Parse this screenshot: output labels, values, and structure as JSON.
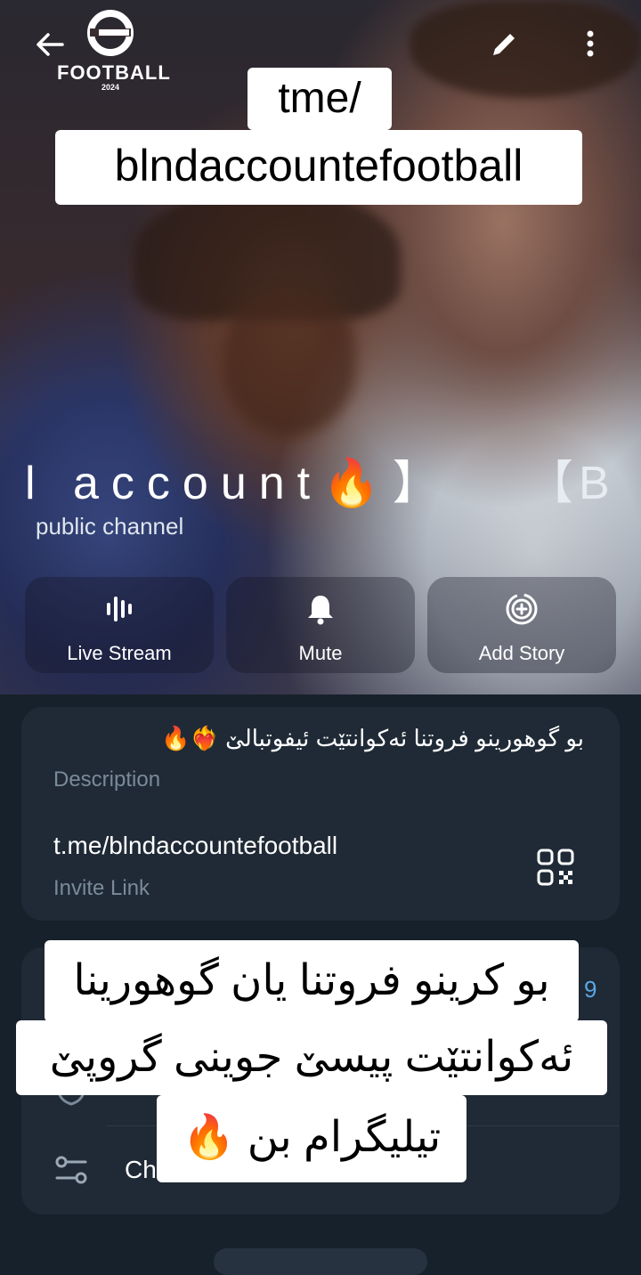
{
  "header": {
    "back_icon": "arrow-left-icon",
    "edit_icon": "pencil-icon",
    "more_icon": "more-vertical-icon",
    "logo_text": "FOOTBALL",
    "logo_year": "2024"
  },
  "video_caption": {
    "line1": "tme/",
    "line2": "blndaccountefootball"
  },
  "channel": {
    "name": "l account🔥】",
    "name_right": "【B",
    "subtitle": "public channel"
  },
  "actions": [
    {
      "label": "Live Stream",
      "icon": "live-stream-icon"
    },
    {
      "label": "Mute",
      "icon": "bell-icon"
    },
    {
      "label": "Add Story",
      "icon": "add-story-icon"
    }
  ],
  "info": {
    "description": "بو گوهورینو فروتنا ئەکوانتێت ئیفوتبالێ ❤️‍🔥🔥",
    "description_label": "Description",
    "invite_link": "t.me/blndaccountefootball",
    "invite_label": "Invite Link",
    "qr_icon": "qr-code-icon"
  },
  "second_card": {
    "count_fragment": "9",
    "settings_label": "Ch",
    "settings_icon": "sliders-icon",
    "shield_icon": "shield-icon"
  },
  "overlay_caption": {
    "line1": "بو کرینو فروتنا یان گوهورینا",
    "line2": "ئەکوانتێت پیسێ جوینی گروپێ",
    "line3": "تیلیگرام بن 🔥"
  },
  "colors": {
    "background": "#17212b",
    "card": "#1f2a36",
    "muted_text": "#7b8a99",
    "accent": "#5aa7e6"
  }
}
